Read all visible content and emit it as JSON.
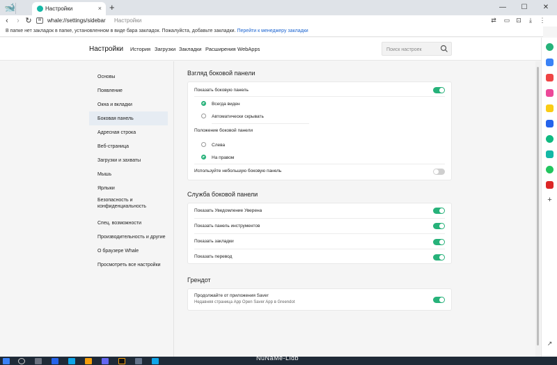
{
  "window": {
    "tab_title": "Настройки",
    "new_tab": "+",
    "tab_close": "×",
    "minimize": "—",
    "maximize": "☐",
    "close": "✕"
  },
  "toolbar": {
    "url": "whale://settings/sidebar",
    "url_page_title": "Настройки",
    "url_chip": "W"
  },
  "bookmarks_bar": {
    "message": "В папке нет закладок в папке, установленном в виде бара закладок. Пожалуйста, добавьте закладки.",
    "link": "Перейти к менеджеру закладки"
  },
  "header": {
    "title": "Настройки",
    "nav": [
      "История",
      "Загрузки",
      "Закладки",
      "Расширения",
      "WebApps"
    ],
    "search_placeholder": "Поиск настроек"
  },
  "sidebar": {
    "items": [
      "Основы",
      "Появление",
      "Окна и вкладки",
      "Боковая панель",
      "Адресная строка",
      "Веб-страница",
      "Загрузки и захваты",
      "Мышь",
      "Ярлыки",
      "Безопасность и",
      "конфиденциальность",
      "Спец. возможности",
      "Производительность и другие",
      "О браузере Whale",
      "Просмотреть все настройки"
    ],
    "active_index": 3
  },
  "sections": {
    "appearance": {
      "title": "Взгляд боковой панели",
      "show_sidebar": {
        "label": "Показать боковую панель",
        "on": true
      },
      "visibility_options": [
        "Всегда виден",
        "Автоматически скрывать"
      ],
      "visibility_selected": 0,
      "position_label": "Положение боковой панели",
      "position_options": [
        "Слева",
        "На правом"
      ],
      "position_selected": 1,
      "small_sidebar": {
        "label": "Используйте небольшую боковую панель",
        "on": false
      }
    },
    "service": {
      "title": "Служба боковой панели",
      "items": [
        {
          "label": "Показать Уведомление Уверена",
          "on": true
        },
        {
          "label": "Показать панель инструментов",
          "on": true
        },
        {
          "label": "Показать закладки",
          "on": true
        },
        {
          "label": "Показать перевод",
          "on": true
        }
      ]
    },
    "greendot": {
      "title": "Грендот",
      "item": {
        "label": "Продолжайте от приложения Saver",
        "sublabel": "Недавняя страница App Open Saver App в Greendot",
        "on": true
      }
    }
  },
  "watermark": "NuNaMe-Lidb",
  "colors": {
    "accent": "#27b27a",
    "active_menu_bg": "#e6ecf3",
    "link": "#1a63d0"
  }
}
